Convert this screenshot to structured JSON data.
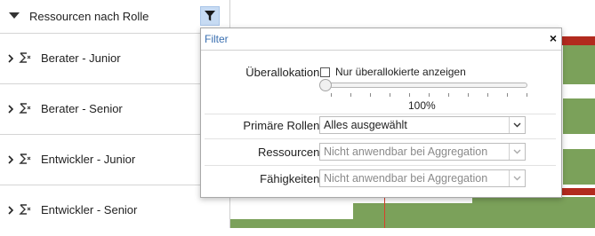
{
  "header": {
    "title": "Ressourcen nach Rolle"
  },
  "rows": [
    {
      "label": "Berater - Junior"
    },
    {
      "label": "Berater - Senior"
    },
    {
      "label": "Entwickler - Junior"
    },
    {
      "label": "Entwickler - Senior"
    }
  ],
  "filter": {
    "title": "Filter",
    "close": "×",
    "overallocation_label": "Überallokation:",
    "overallocation_checkbox_label": "Nur überallokierte anzeigen",
    "overallocation_checked": false,
    "slider_value_text": "100%",
    "slider_fraction": 0.0,
    "roles_label": "Primäre Rollen:",
    "roles_value": "Alles ausgewählt",
    "resources_label": "Ressourcen:",
    "resources_value": "Nicht anwendbar bei Aggregation",
    "skills_label": "Fähigkeiten:",
    "skills_value": "Nicht anwendbar bei Aggregation"
  },
  "colors": {
    "bar_green": "#7ba15a",
    "bar_red": "#b22a1e",
    "accent_blue": "#3a6fb0",
    "filter_button": "#c7dbf3"
  },
  "icons": {
    "collapse": "triangle-down-icon",
    "filter": "funnel-icon",
    "expand": "chevron-right-icon",
    "aggregate": "sigma-icon",
    "close": "close-icon",
    "dropdown": "chevron-down-icon"
  }
}
